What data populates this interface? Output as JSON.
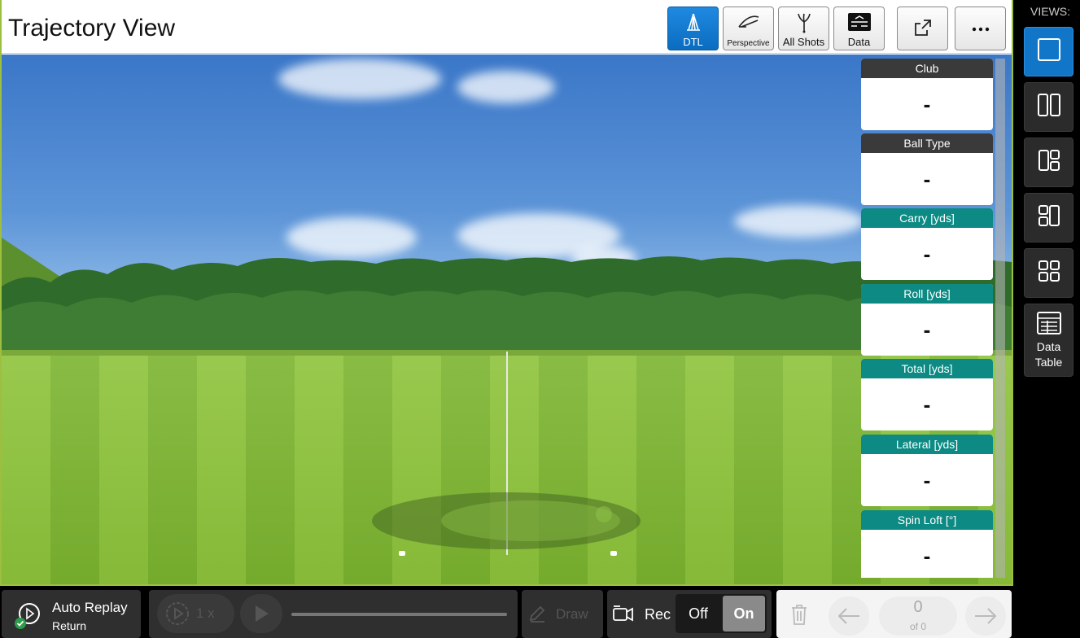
{
  "header": {
    "title": "Trajectory View"
  },
  "toolbar": [
    {
      "label": "DTL",
      "icon": "dtl-icon",
      "active": true
    },
    {
      "label": "Perspective",
      "icon": "perspective-icon",
      "active": false
    },
    {
      "label": "All Shots",
      "icon": "all-shots-icon",
      "active": false
    },
    {
      "label": "Data",
      "icon": "data-icon",
      "active": false
    }
  ],
  "toolbar_extra": {
    "popout_icon": "popout-icon",
    "more_icon": "more-icon"
  },
  "cards": [
    {
      "title": "Club",
      "value": "-",
      "style": "dark"
    },
    {
      "title": "Ball Type",
      "value": "-",
      "style": "dark"
    },
    {
      "title": "Carry [yds]",
      "value": "-",
      "style": "teal"
    },
    {
      "title": "Roll [yds]",
      "value": "-",
      "style": "teal"
    },
    {
      "title": "Total [yds]",
      "value": "-",
      "style": "teal"
    },
    {
      "title": "Lateral [yds]",
      "value": "-",
      "style": "teal"
    },
    {
      "title": "Spin Loft [°]",
      "value": "-",
      "style": "teal"
    }
  ],
  "views": {
    "label": "VIEWS:",
    "items": [
      {
        "name": "single-view",
        "icon": "single-layout-icon",
        "active": true
      },
      {
        "name": "split-view",
        "icon": "split-layout-icon",
        "active": false
      },
      {
        "name": "left-large-view",
        "icon": "left-large-layout-icon",
        "active": false
      },
      {
        "name": "right-large-view",
        "icon": "right-large-layout-icon",
        "active": false
      },
      {
        "name": "quad-view",
        "icon": "quad-layout-icon",
        "active": false
      },
      {
        "name": "data-table-view",
        "icon": "table-icon",
        "label_line1": "Data",
        "label_line2": "Table",
        "active": false
      }
    ]
  },
  "bottom": {
    "auto_replay": {
      "title": "Auto Replay",
      "subtitle": "Return"
    },
    "playback": {
      "speed": "1 x"
    },
    "draw": {
      "label": "Draw"
    },
    "rec": {
      "label": "Rec",
      "off": "Off",
      "on": "On",
      "state": "On"
    },
    "nav": {
      "count": "0",
      "of": "of 0"
    }
  },
  "colors": {
    "accent": "#1176c8",
    "teal": "#0c8a83",
    "card_dark": "#3a3a3a"
  }
}
